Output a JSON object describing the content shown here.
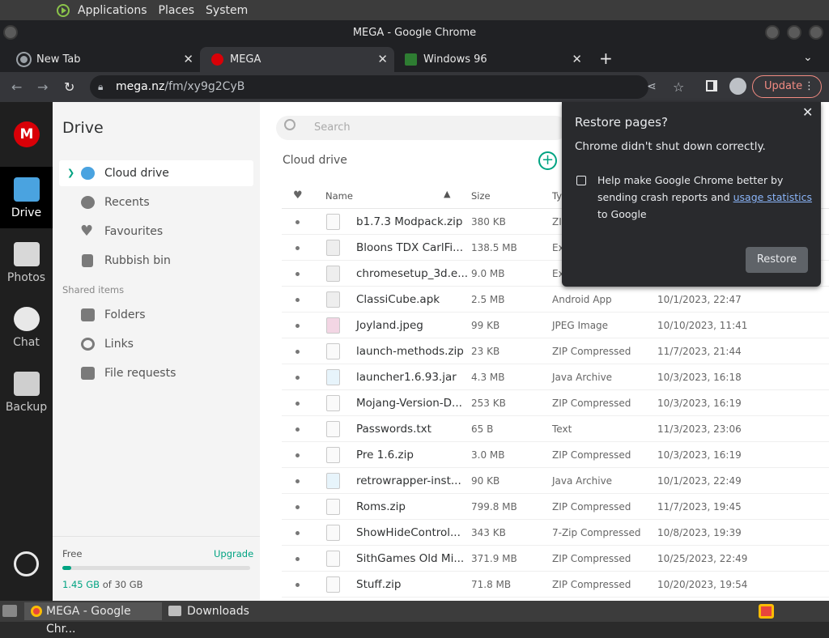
{
  "system_panel": {
    "menu": [
      "Applications",
      "Places",
      "System"
    ]
  },
  "window": {
    "title": "MEGA - Google Chrome"
  },
  "tabs": [
    {
      "label": "New Tab"
    },
    {
      "label": "MEGA"
    },
    {
      "label": "Windows 96"
    }
  ],
  "address": {
    "host": "mega.nz",
    "path": "/fm/xy9g2CyB"
  },
  "update_label": "Update",
  "rail": {
    "logo": "M",
    "items": [
      "Drive",
      "Photos",
      "Chat",
      "Backup"
    ]
  },
  "drive": {
    "title": "Drive",
    "items": [
      "Cloud drive",
      "Recents",
      "Favourites",
      "Rubbish bin"
    ],
    "shared_header": "Shared items",
    "shared_items": [
      "Folders",
      "Links",
      "File requests"
    ],
    "storage": {
      "free_label": "Free",
      "upgrade_label": "Upgrade",
      "used": "1.45 GB",
      "of_total": "of 30 GB",
      "used_fraction": 0.048
    }
  },
  "main": {
    "search_placeholder": "Search",
    "breadcrumb": "Cloud drive",
    "headers": {
      "name": "Name",
      "size": "Size",
      "type": "Ty"
    },
    "files": [
      {
        "name": "b1.7.3 Modpack.zip",
        "size": "380 KB",
        "type": "ZIP",
        "date": "",
        "icon": "zip"
      },
      {
        "name": "Bloons TDX CarlFi...",
        "size": "138.5 MB",
        "type": "Ex",
        "date": "",
        "icon": "exe"
      },
      {
        "name": "chromesetup_3d.e...",
        "size": "9.0 MB",
        "type": "Ex",
        "date": "",
        "icon": "exe"
      },
      {
        "name": "ClassiCube.apk",
        "size": "2.5 MB",
        "type": "Android App",
        "date": "10/1/2023, 22:47",
        "icon": "exe"
      },
      {
        "name": "Joyland.jpeg",
        "size": "99 KB",
        "type": "JPEG Image",
        "date": "10/10/2023, 11:41",
        "icon": "image"
      },
      {
        "name": "launch-methods.zip",
        "size": "23 KB",
        "type": "ZIP Compressed",
        "date": "11/7/2023, 21:44",
        "icon": "zip"
      },
      {
        "name": "launcher1.6.93.jar",
        "size": "4.3 MB",
        "type": "Java Archive",
        "date": "10/3/2023, 16:18",
        "icon": "code"
      },
      {
        "name": "Mojang-Version-D...",
        "size": "253 KB",
        "type": "ZIP Compressed",
        "date": "10/3/2023, 16:19",
        "icon": "zip"
      },
      {
        "name": "Passwords.txt",
        "size": "65 B",
        "type": "Text",
        "date": "11/3/2023, 23:06",
        "icon": "text"
      },
      {
        "name": "Pre 1.6.zip",
        "size": "3.0 MB",
        "type": "ZIP Compressed",
        "date": "10/3/2023, 16:19",
        "icon": "zip"
      },
      {
        "name": "retrowrapper-inst...",
        "size": "90 KB",
        "type": "Java Archive",
        "date": "10/1/2023, 22:49",
        "icon": "code"
      },
      {
        "name": "Roms.zip",
        "size": "799.8 MB",
        "type": "ZIP Compressed",
        "date": "11/7/2023, 19:45",
        "icon": "zip"
      },
      {
        "name": "ShowHideControl...",
        "size": "343 KB",
        "type": "7-Zip Compressed",
        "date": "10/8/2023, 19:39",
        "icon": "zip"
      },
      {
        "name": "SithGames Old Mi...",
        "size": "371.9 MB",
        "type": "ZIP Compressed",
        "date": "10/25/2023, 22:49",
        "icon": "zip"
      },
      {
        "name": "Stuff.zip",
        "size": "71.8 MB",
        "type": "ZIP Compressed",
        "date": "10/20/2023, 19:54",
        "icon": "zip"
      }
    ]
  },
  "restore_popup": {
    "title": "Restore pages?",
    "message": "Chrome didn't shut down correctly.",
    "checkbox_text_1": "Help make Google Chrome better by sending crash reports and ",
    "checkbox_link": "usage statistics",
    "checkbox_text_2": " to Google",
    "button": "Restore"
  },
  "taskbar": {
    "items": [
      "MEGA - Google Chr...",
      "Downloads"
    ]
  },
  "colors": {
    "mega_red": "#d90007",
    "accent_green": "#00a382",
    "link_blue": "#8ab4f8"
  }
}
